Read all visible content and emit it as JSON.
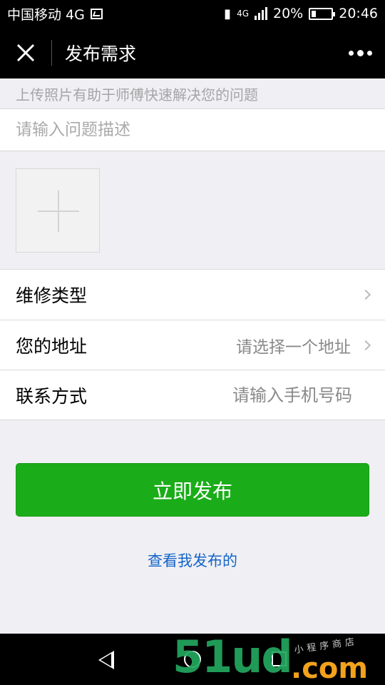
{
  "status_bar": {
    "carrier": "中国移动 4G",
    "network": "4G",
    "battery": "20%",
    "time": "20:46"
  },
  "nav": {
    "title": "发布需求",
    "close_icon": "close-icon",
    "more_icon": "more-icon"
  },
  "form": {
    "hint": "上传照片有助于师傅快速解决您的问题",
    "description_placeholder": "请输入问题描述",
    "upload_icon": "plus-icon",
    "rows": [
      {
        "label": "维修类型",
        "value": ""
      },
      {
        "label": "您的地址",
        "value": "请选择一个地址"
      },
      {
        "label": "联系方式",
        "placeholder": "请输入手机号码"
      }
    ]
  },
  "actions": {
    "publish_label": "立即发布",
    "my_posts_label": "查看我发布的"
  },
  "watermark": {
    "main": "51ud",
    "tld": ".com",
    "tagline": "小程序商店"
  },
  "colors": {
    "primary_green": "#1aad19",
    "link_blue": "#1464c8",
    "background": "#efeff4"
  }
}
